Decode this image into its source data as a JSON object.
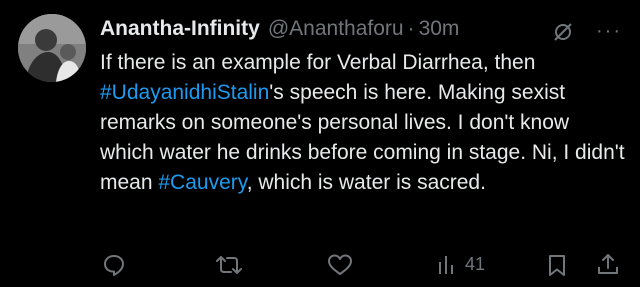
{
  "tweet": {
    "author_name": "Anantha-Infinity",
    "handle": "@Ananthaforu",
    "separator": "·",
    "time": "30m",
    "more": "···",
    "text": {
      "t1": "If there is an example for Verbal Diarrhea, then ",
      "hashtag1": "#UdayanidhiStalin",
      "t2": "'s speech is here. Making sexist remarks on someone's personal lives. I don't know which water he drinks before coming in stage. Ni, I didn't mean ",
      "hashtag2": "#Cauvery",
      "t3": ", which is water is sacred."
    }
  },
  "actions": {
    "views_count": "41"
  },
  "colors": {
    "background": "#000000",
    "text": "#e7e9ea",
    "muted": "#71767b",
    "link": "#1d9bf0"
  },
  "icons": [
    "avatar-photo",
    "grok-icon",
    "more-icon",
    "reply-icon",
    "retweet-icon",
    "like-icon",
    "views-icon",
    "bookmark-icon",
    "share-icon"
  ]
}
